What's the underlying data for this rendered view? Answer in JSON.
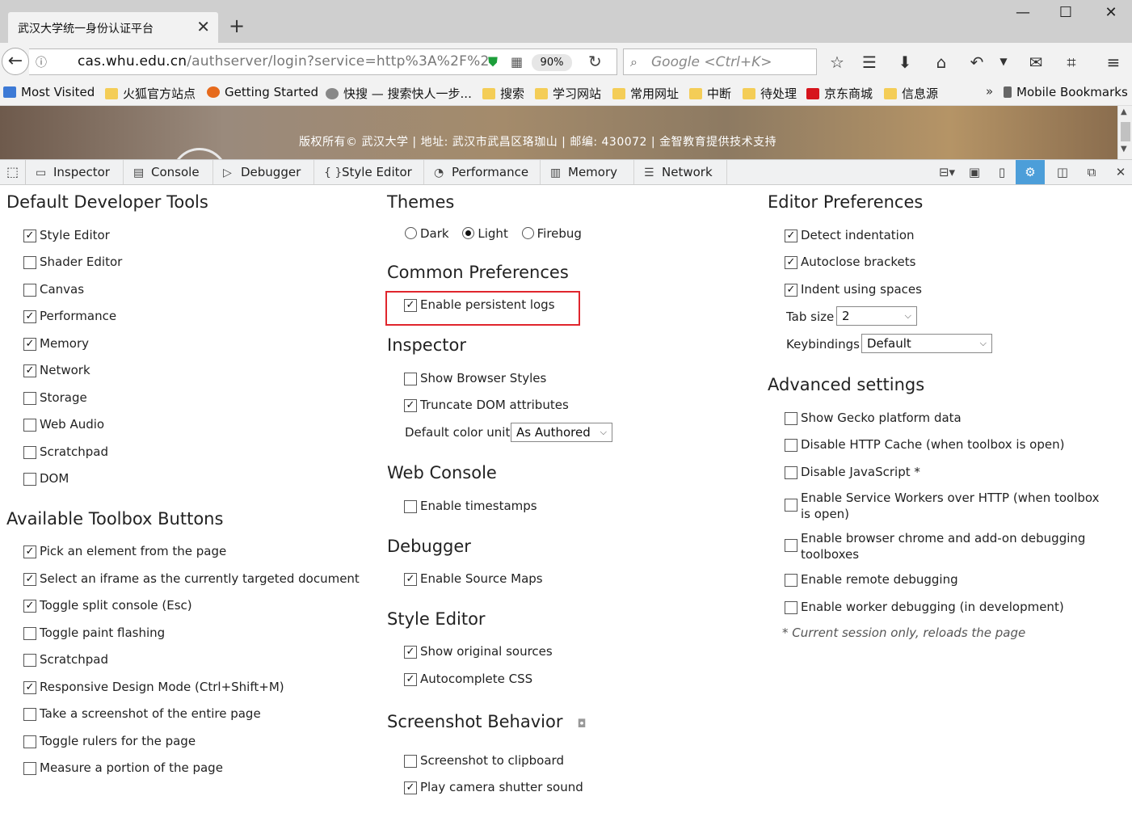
{
  "browser": {
    "tab_title": "武汉大学统一身份认证平台",
    "tab_close": "✕",
    "new_tab": "+",
    "window_controls": {
      "minimize": "—",
      "maximize": "☐",
      "close": "✕"
    },
    "url_host": "cas.whu.edu.cn",
    "url_path": "/authserver/login?service=http%3A%2F%2",
    "zoom": "90%",
    "search_placeholder": "Google <Ctrl+K>"
  },
  "bookmarks": [
    {
      "label": "Most Visited",
      "icon": "globe-icon"
    },
    {
      "label": "火狐官方站点",
      "icon": "folder-icon"
    },
    {
      "label": "Getting Started",
      "icon": "firefox-icon"
    },
    {
      "label": "快搜 — 搜索快人一步...",
      "icon": "globe-icon"
    },
    {
      "label": "搜索",
      "icon": "folder-icon"
    },
    {
      "label": "学习网站",
      "icon": "folder-icon"
    },
    {
      "label": "常用网址",
      "icon": "folder-icon"
    },
    {
      "label": "中断",
      "icon": "folder-icon"
    },
    {
      "label": "待处理",
      "icon": "folder-icon"
    },
    {
      "label": "京东商城",
      "icon": "jd-icon"
    },
    {
      "label": "信息源",
      "icon": "folder-icon"
    }
  ],
  "bookmarks_more": "»",
  "mobile_bookmarks": "Mobile Bookmarks",
  "page_footer": "版权所有© 武汉大学 | 地址: 武汉市武昌区珞珈山 | 邮编: 430072 | 金智教育提供技术支持",
  "devtools": {
    "tabs": [
      {
        "label": "Inspector",
        "icon": "inspector-icon"
      },
      {
        "label": "Console",
        "icon": "console-icon"
      },
      {
        "label": "Debugger",
        "icon": "debugger-icon"
      },
      {
        "label": "Style Editor",
        "icon": "style-editor-icon"
      },
      {
        "label": "Performance",
        "icon": "performance-icon"
      },
      {
        "label": "Memory",
        "icon": "memory-icon"
      },
      {
        "label": "Network",
        "icon": "network-icon"
      }
    ],
    "active_right_button": "settings-icon"
  },
  "options": {
    "default_tools": {
      "heading": "Default Developer Tools",
      "items": [
        {
          "label": "Style Editor",
          "checked": true
        },
        {
          "label": "Shader Editor",
          "checked": false
        },
        {
          "label": "Canvas",
          "checked": false
        },
        {
          "label": "Performance",
          "checked": true
        },
        {
          "label": "Memory",
          "checked": true
        },
        {
          "label": "Network",
          "checked": true
        },
        {
          "label": "Storage",
          "checked": false
        },
        {
          "label": "Web Audio",
          "checked": false
        },
        {
          "label": "Scratchpad",
          "checked": false
        },
        {
          "label": "DOM",
          "checked": false
        }
      ]
    },
    "toolbox_buttons": {
      "heading": "Available Toolbox Buttons",
      "items": [
        {
          "label": "Pick an element from the page",
          "checked": true
        },
        {
          "label": "Select an iframe as the currently targeted document",
          "checked": true
        },
        {
          "label": "Toggle split console (Esc)",
          "checked": true
        },
        {
          "label": "Toggle paint flashing",
          "checked": false
        },
        {
          "label": "Scratchpad",
          "checked": false
        },
        {
          "label": "Responsive Design Mode (Ctrl+Shift+M)",
          "checked": true
        },
        {
          "label": "Take a screenshot of the entire page",
          "checked": false
        },
        {
          "label": "Toggle rulers for the page",
          "checked": false
        },
        {
          "label": "Measure a portion of the page",
          "checked": false
        }
      ]
    },
    "themes": {
      "heading": "Themes",
      "options": [
        {
          "label": "Dark",
          "selected": false
        },
        {
          "label": "Light",
          "selected": true
        },
        {
          "label": "Firebug",
          "selected": false
        }
      ]
    },
    "common": {
      "heading": "Common Preferences",
      "items": [
        {
          "label": "Enable persistent logs",
          "checked": true
        }
      ]
    },
    "inspector": {
      "heading": "Inspector",
      "items": [
        {
          "label": "Show Browser Styles",
          "checked": false
        },
        {
          "label": "Truncate DOM attributes",
          "checked": true
        }
      ],
      "color_unit_label": "Default color unit",
      "color_unit_value": "As Authored"
    },
    "web_console": {
      "heading": "Web Console",
      "items": [
        {
          "label": "Enable timestamps",
          "checked": false
        }
      ]
    },
    "debugger": {
      "heading": "Debugger",
      "items": [
        {
          "label": "Enable Source Maps",
          "checked": true
        }
      ]
    },
    "style_editor": {
      "heading": "Style Editor",
      "items": [
        {
          "label": "Show original sources",
          "checked": true
        },
        {
          "label": "Autocomplete CSS",
          "checked": true
        }
      ]
    },
    "screenshot": {
      "heading": "Screenshot Behavior",
      "items": [
        {
          "label": "Screenshot to clipboard",
          "checked": false
        },
        {
          "label": "Play camera shutter sound",
          "checked": true
        }
      ]
    },
    "editor": {
      "heading": "Editor Preferences",
      "items": [
        {
          "label": "Detect indentation",
          "checked": true
        },
        {
          "label": "Autoclose brackets",
          "checked": true
        },
        {
          "label": "Indent using spaces",
          "checked": true
        }
      ],
      "tab_size_label": "Tab size",
      "tab_size_value": "2",
      "keybindings_label": "Keybindings",
      "keybindings_value": "Default"
    },
    "advanced": {
      "heading": "Advanced settings",
      "items": [
        {
          "label": "Show Gecko platform data",
          "checked": false
        },
        {
          "label": "Disable HTTP Cache (when toolbox is open)",
          "checked": false
        },
        {
          "label": "Disable JavaScript *",
          "checked": false
        },
        {
          "label": "Enable Service Workers over HTTP (when toolbox is open)",
          "checked": false
        },
        {
          "label": "Enable browser chrome and add-on debugging toolboxes",
          "checked": false
        },
        {
          "label": "Enable remote debugging",
          "checked": false
        },
        {
          "label": "Enable worker debugging (in development)",
          "checked": false
        }
      ],
      "note": "* Current session only, reloads the page"
    }
  }
}
